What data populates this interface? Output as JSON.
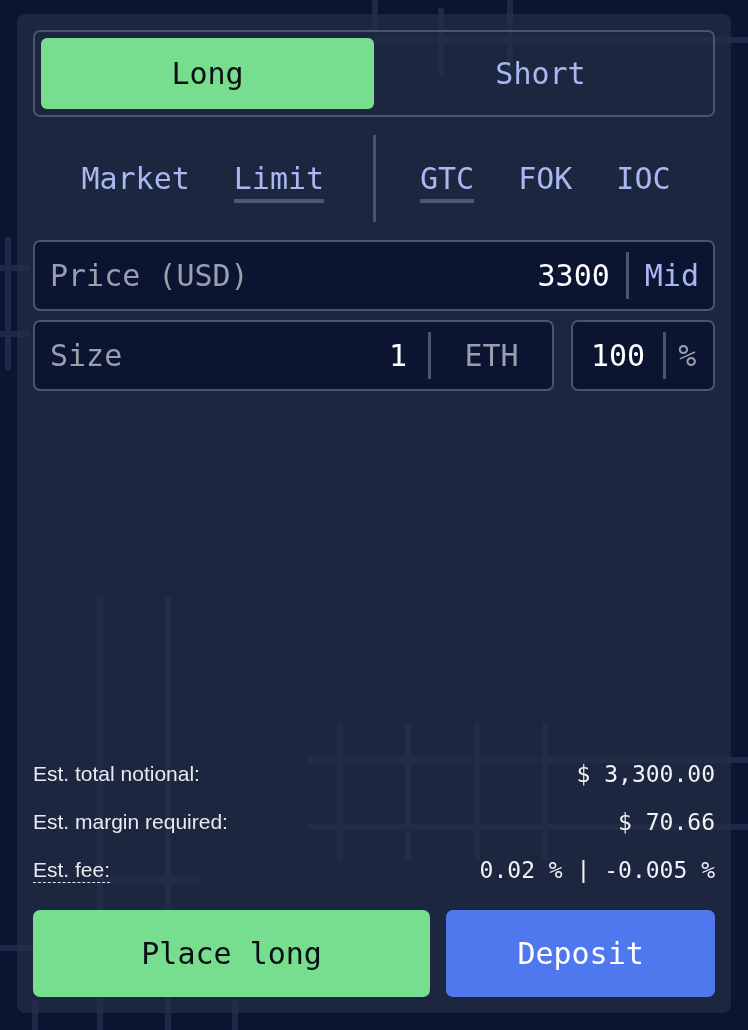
{
  "side_tabs": [
    {
      "label": "Long",
      "selected": true
    },
    {
      "label": "Short",
      "selected": false
    }
  ],
  "order_types": [
    {
      "label": "Market",
      "selected": false
    },
    {
      "label": "Limit",
      "selected": true
    }
  ],
  "time_in_force": [
    {
      "label": "GTC",
      "selected": true
    },
    {
      "label": "FOK",
      "selected": false
    },
    {
      "label": "IOC",
      "selected": false
    }
  ],
  "price_field": {
    "label": "Price (USD)",
    "value": "3300",
    "button": "Mid"
  },
  "size_field": {
    "label": "Size",
    "value": "1",
    "unit": "ETH"
  },
  "percent_field": {
    "value": "100",
    "unit": "%"
  },
  "summary": [
    {
      "label": "Est. total notional:",
      "value": "$ 3,300.00",
      "kind": "plain"
    },
    {
      "label": "Est. margin required:",
      "value": "$ 70.66",
      "kind": "plain"
    },
    {
      "label": "Est. fee:",
      "value": "0.02 % | -0.005 %",
      "kind": "hint"
    }
  ],
  "buttons": [
    {
      "label": "Place long",
      "kind": "primary"
    },
    {
      "label": "Deposit",
      "kind": "secondary"
    }
  ]
}
